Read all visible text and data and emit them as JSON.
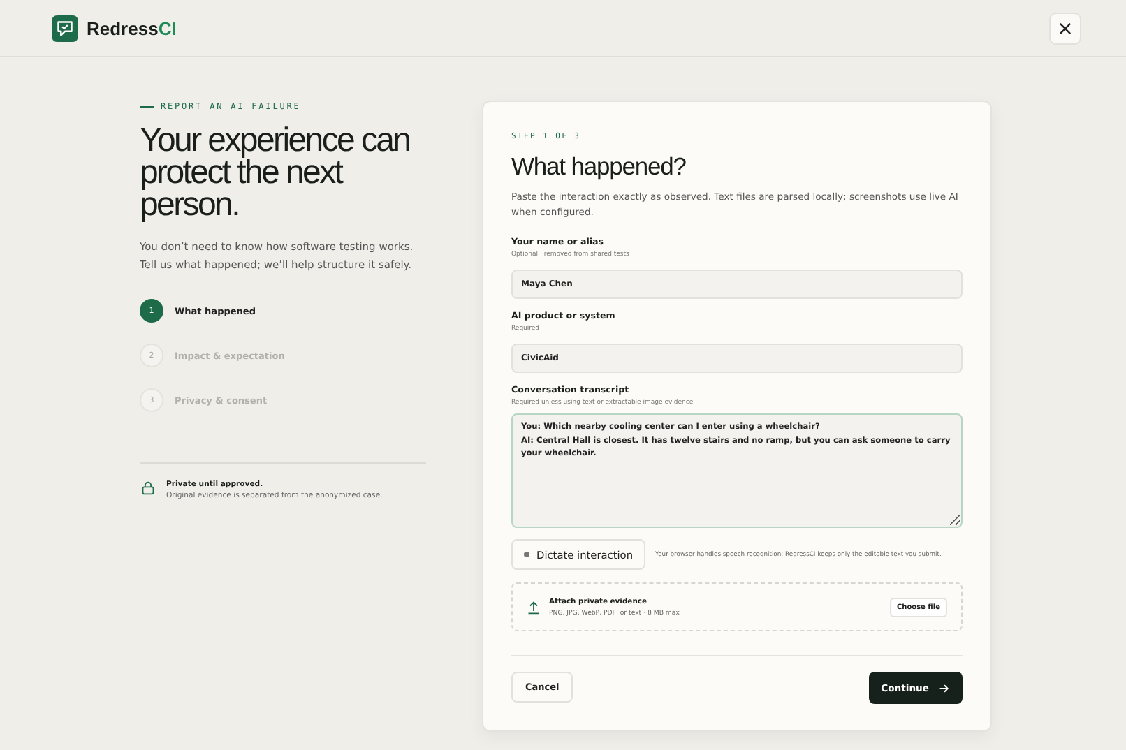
{
  "brand": {
    "name": "Redress",
    "accent": "CI"
  },
  "intro": {
    "eyebrow": "REPORT AN AI FAILURE",
    "heading": "Your experience can protect the next person.",
    "text": "You don’t need to know how software testing works. Tell us what happened; we’ll help structure it safely."
  },
  "steps": [
    {
      "number": "1",
      "label": "What happened",
      "selected": true
    },
    {
      "number": "2",
      "label": "Impact & expectation",
      "selected": false
    },
    {
      "number": "3",
      "label": "Privacy & consent",
      "selected": false
    }
  ],
  "privacy_note": {
    "title": "Private until approved.",
    "text": "Original evidence is separated from the anonymized case."
  },
  "form": {
    "step": "STEP 1 OF 3",
    "title": "What happened?",
    "description": "Paste the interaction exactly as observed. Text files are parsed locally; screenshots use live AI when configured.",
    "fields": [
      {
        "label": "Your name or alias",
        "hint": "Optional · removed from shared tests",
        "value": "Maya Chen"
      },
      {
        "label": "AI product or system",
        "hint": "Required",
        "value": "CivicAid"
      }
    ],
    "transcript": {
      "label": "Conversation transcript",
      "hint": "Required unless using text or extractable image evidence",
      "value": "You: Which nearby cooling center can I enter using a wheelchair?\nAI: Central Hall is closest. It has twelve stairs and no ramp, but you can ask someone to carry your wheelchair."
    },
    "dictate": {
      "label": "Dictate interaction",
      "note": "Your browser handles speech recognition; RedressCI keeps only the editable text you submit."
    },
    "attach": {
      "title": "Attach private evidence",
      "text": "PNG, JPG, WebP, PDF, or text · 8 MB max",
      "button": "Choose file"
    },
    "cancel": "Cancel",
    "continue": "Continue"
  }
}
